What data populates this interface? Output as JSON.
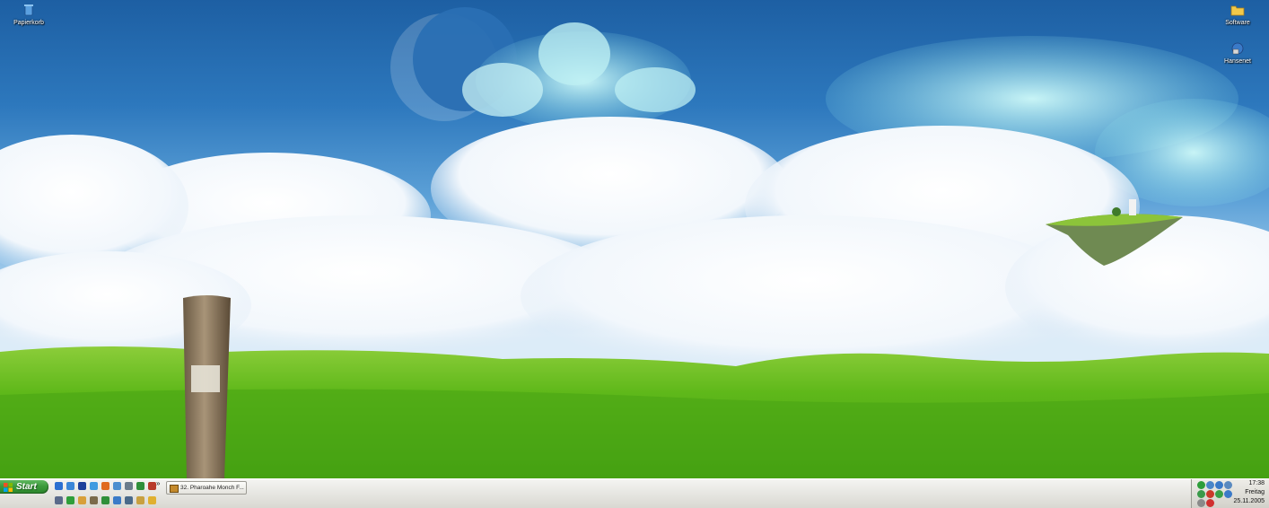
{
  "desktop": {
    "icons": [
      {
        "label": "Papierkorb",
        "icon": "recycle-bin-icon"
      },
      {
        "label": "Software",
        "icon": "folder-icon"
      },
      {
        "label": "Hansenet",
        "icon": "network-icon"
      }
    ]
  },
  "taskbar": {
    "start_label": "Start",
    "overflow_chevron": "»",
    "quick_launch": [
      {
        "icon": "internet-explorer-icon",
        "color": "#2b6fd1"
      },
      {
        "icon": "help-icon",
        "color": "#3a86d8"
      },
      {
        "icon": "save-icon",
        "color": "#1d3f9a"
      },
      {
        "icon": "messenger-icon",
        "color": "#3f9be0"
      },
      {
        "icon": "firefox-icon",
        "color": "#e06b1f"
      },
      {
        "icon": "media-player-icon",
        "color": "#4a8fd0"
      },
      {
        "icon": "network-icon",
        "color": "#6a7c8c"
      },
      {
        "icon": "game-icon",
        "color": "#2f8f3a"
      },
      {
        "icon": "photo-icon",
        "color": "#b83a2a"
      },
      {
        "icon": "text-icon",
        "color": "#5a6a8a"
      },
      {
        "icon": "shield-icon",
        "color": "#2e9e3a"
      },
      {
        "icon": "paint-icon",
        "color": "#d8a03a"
      },
      {
        "icon": "trash-icon",
        "color": "#7a6a4a"
      },
      {
        "icon": "windows-icon",
        "color": "#2f8f3a"
      },
      {
        "icon": "globe-icon",
        "color": "#3a7ac8"
      },
      {
        "icon": "phone-icon",
        "color": "#4a6a8a"
      },
      {
        "icon": "tools-icon",
        "color": "#c8a040"
      },
      {
        "icon": "smile-icon",
        "color": "#e0b030"
      }
    ],
    "tasks": [
      {
        "label": "32. Pharoahe Monch F...",
        "icon": "winamp-icon"
      }
    ],
    "tray_icons": [
      {
        "icon": "tray-green-icon",
        "color": "#2e9e3a"
      },
      {
        "icon": "tray-monitor-icon",
        "color": "#4a86c8"
      },
      {
        "icon": "tray-network-icon",
        "color": "#3a7ac8"
      },
      {
        "icon": "tray-monitor-icon",
        "color": "#5a8ac0"
      },
      {
        "icon": "tray-shield-icon",
        "color": "#3a9a4a"
      },
      {
        "icon": "tray-red-icon",
        "color": "#c83a2a"
      },
      {
        "icon": "tray-green-icon",
        "color": "#38a048"
      },
      {
        "icon": "tray-globe-icon",
        "color": "#3a7ac8"
      },
      {
        "icon": "tray-settings-icon",
        "color": "#8a8a8a"
      },
      {
        "icon": "tray-alert-icon",
        "color": "#d03030"
      }
    ],
    "clock": {
      "time": "17:38",
      "day": "Freitag",
      "date": "25.11.2005"
    }
  },
  "colors": {
    "start_green": "#3c9a3c",
    "sky_blue": "#2d78bd",
    "grass_green": "#5fb81a"
  }
}
